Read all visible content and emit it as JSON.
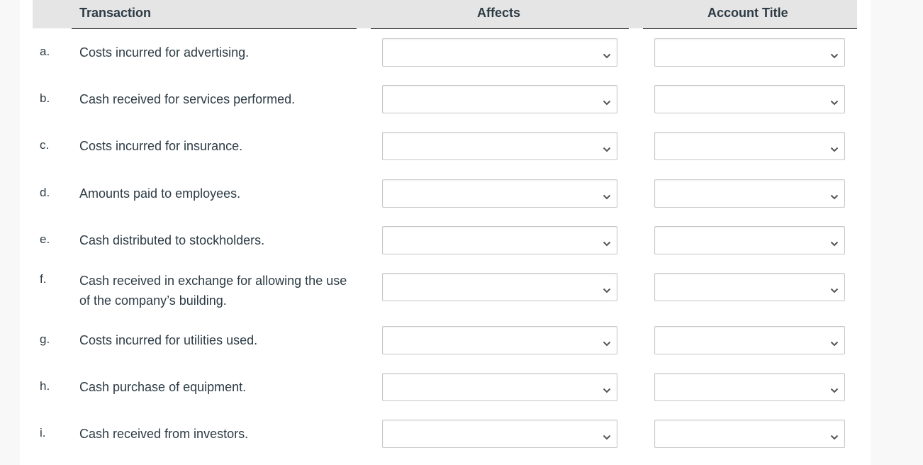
{
  "table": {
    "headers": {
      "transaction": "Transaction",
      "affects": "Affects",
      "account_title": "Account Title"
    },
    "rows": [
      {
        "letter": "a.",
        "text": "Costs incurred for advertising.",
        "affects": "",
        "account_title": ""
      },
      {
        "letter": "b.",
        "text": "Cash received for services performed.",
        "affects": "",
        "account_title": ""
      },
      {
        "letter": "c.",
        "text": "Costs incurred for insurance.",
        "affects": "",
        "account_title": ""
      },
      {
        "letter": "d.",
        "text": "Amounts paid to employees.",
        "affects": "",
        "account_title": ""
      },
      {
        "letter": "e.",
        "text": "Cash distributed to stockholders.",
        "affects": "",
        "account_title": ""
      },
      {
        "letter": "f.",
        "text": "Cash received in exchange for allowing the use of the company’s building.",
        "affects": "",
        "account_title": ""
      },
      {
        "letter": "g.",
        "text": "Costs incurred for utilities used.",
        "affects": "",
        "account_title": ""
      },
      {
        "letter": "h.",
        "text": "Cash purchase of equipment.",
        "affects": "",
        "account_title": ""
      },
      {
        "letter": "i.",
        "text": "Cash received from investors.",
        "affects": "",
        "account_title": ""
      }
    ]
  },
  "icons": {
    "dropdown": "chevron-down-icon"
  },
  "colors": {
    "header_bg": "#e5e5e5",
    "text": "#2d3b45",
    "select_border": "#c7c7c7",
    "page_bg": "#f8f8f8"
  }
}
